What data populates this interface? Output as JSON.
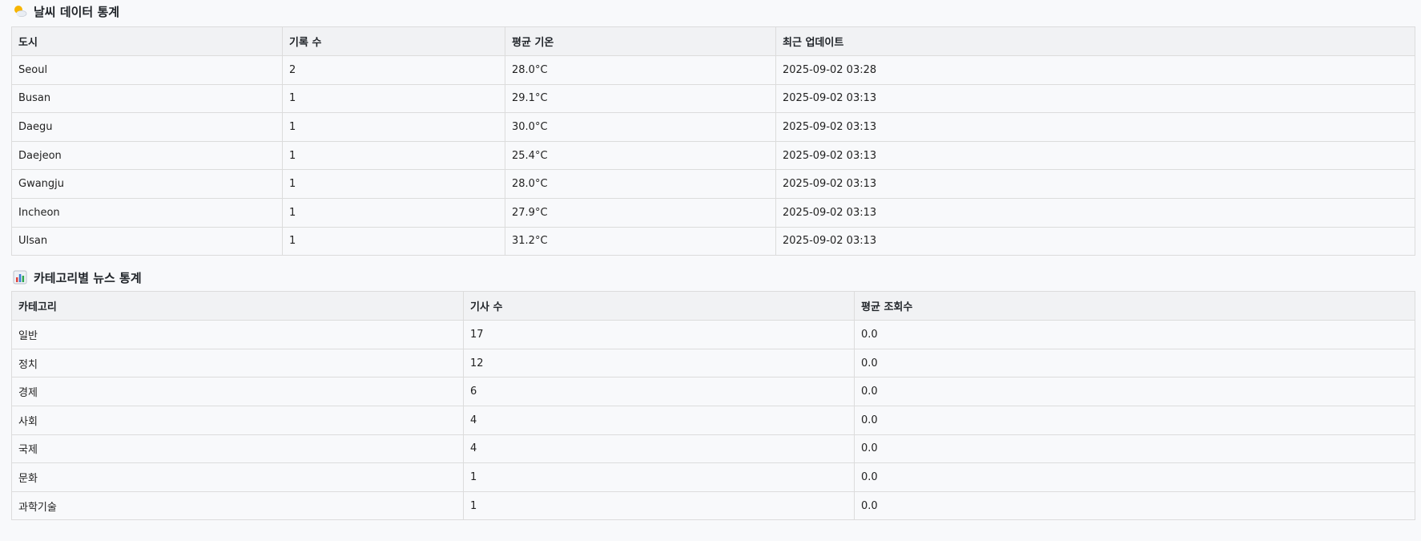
{
  "weather": {
    "title": "날씨 데이터 통계",
    "icon": "sun-behind-cloud-icon",
    "columns": [
      "도시",
      "기록 수",
      "평균 기온",
      "최근 업데이트"
    ],
    "rows": [
      [
        "Seoul",
        "2",
        "28.0°C",
        "2025-09-02 03:28"
      ],
      [
        "Busan",
        "1",
        "29.1°C",
        "2025-09-02 03:13"
      ],
      [
        "Daegu",
        "1",
        "30.0°C",
        "2025-09-02 03:13"
      ],
      [
        "Daejeon",
        "1",
        "25.4°C",
        "2025-09-02 03:13"
      ],
      [
        "Gwangju",
        "1",
        "28.0°C",
        "2025-09-02 03:13"
      ],
      [
        "Incheon",
        "1",
        "27.9°C",
        "2025-09-02 03:13"
      ],
      [
        "Ulsan",
        "1",
        "31.2°C",
        "2025-09-02 03:13"
      ]
    ]
  },
  "news": {
    "title": "카테고리별 뉴스 통계",
    "icon": "bar-chart-icon",
    "columns": [
      "카테고리",
      "기사 수",
      "평균 조회수"
    ],
    "rows": [
      [
        "일반",
        "17",
        "0.0"
      ],
      [
        "정치",
        "12",
        "0.0"
      ],
      [
        "경제",
        "6",
        "0.0"
      ],
      [
        "사회",
        "4",
        "0.0"
      ],
      [
        "국제",
        "4",
        "0.0"
      ],
      [
        "문화",
        "1",
        "0.0"
      ],
      [
        "과학기술",
        "1",
        "0.0"
      ]
    ]
  }
}
